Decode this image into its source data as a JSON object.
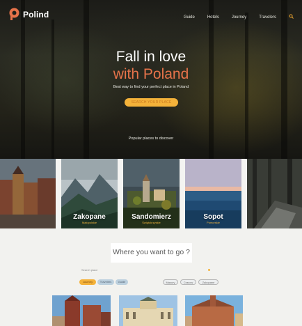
{
  "header": {
    "brand": "Polind",
    "nav": [
      "Guide",
      "Hotels",
      "Journey",
      "Travelers"
    ],
    "search_icon": "search-icon"
  },
  "hero": {
    "title_line1": "Fall in love",
    "title_line2": "with Poland",
    "subtitle": "Best way to find your perfect place in Poland",
    "cta": "SEARCH YOUR PLACE",
    "popular": "Popular places to discover"
  },
  "places": [
    {
      "name": "Zakopane",
      "region": "Małopolskie"
    },
    {
      "name": "Sandomierz",
      "region": "Świętokrzyskie"
    },
    {
      "name": "Sopot",
      "region": "Pomorskie"
    }
  ],
  "finder": {
    "title": "Where you want to go ?",
    "filter_label": "Search place",
    "chips_left": [
      "Journey",
      "Travelers",
      "Guide"
    ],
    "chips_right": [
      "Masury",
      "Cracow",
      "Zakopane"
    ]
  },
  "colors": {
    "accent": "#e6734a",
    "cta": "#f4b23a"
  }
}
